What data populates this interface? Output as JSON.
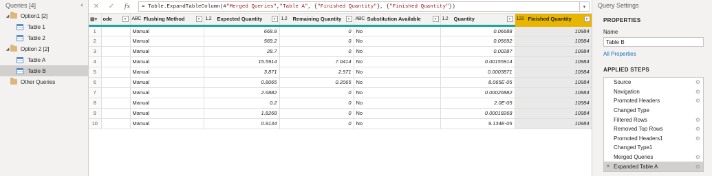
{
  "queries": {
    "title": "Queries [4]",
    "collapse_glyph": "‹",
    "groups": [
      {
        "label": "Option1 [2]",
        "items": [
          {
            "label": "Table 1"
          },
          {
            "label": "Table 2"
          }
        ]
      },
      {
        "label": "Option 2 [2]",
        "items": [
          {
            "label": "Table A"
          },
          {
            "label": "Table B"
          }
        ]
      }
    ],
    "other_label": "Other Queries",
    "selected": "Table B"
  },
  "formula_bar": {
    "cancel_glyph": "✕",
    "commit_glyph": "✓",
    "fx_label": "fx",
    "prefix": "= Table.ExpandTableColumn(#",
    "s1": "\"Merged Queries\"",
    "sep1": ", ",
    "s2": "\"Table A\"",
    "sep2": ", {",
    "s3": "\"Finished Quantity\"",
    "sep3": "}, {",
    "s4": "\"Finished Quantity\"",
    "suffix": "})",
    "expand_glyph": "▾"
  },
  "grid": {
    "corner_glyph": "▦▾",
    "columns": [
      {
        "type": "",
        "label": "ode"
      },
      {
        "type": "ABC",
        "label": "Flushing Method"
      },
      {
        "type": "1.2",
        "label": "Expected Quantity"
      },
      {
        "type": "1.2",
        "label": "Remaining Quantity"
      },
      {
        "type": "ABC",
        "label": "Substitution Available"
      },
      {
        "type": "1.2",
        "label": "Quantity"
      },
      {
        "type": "123",
        "label": "Finished Quantity"
      }
    ],
    "dropdown_glyph": "▾",
    "rows": [
      {
        "n": "1",
        "code": "",
        "flush": "Manual",
        "exp": "668.8",
        "rem": "0",
        "sub": "No",
        "qty": "0.06688",
        "fin": "10984"
      },
      {
        "n": "2",
        "code": "",
        "flush": "Manual",
        "exp": "569.2",
        "rem": "0",
        "sub": "No",
        "qty": "0.05692",
        "fin": "10984"
      },
      {
        "n": "3",
        "code": "",
        "flush": "Manual",
        "exp": "28.7",
        "rem": "0",
        "sub": "No",
        "qty": "0.00287",
        "fin": "10984"
      },
      {
        "n": "4",
        "code": "",
        "flush": "Manual",
        "exp": "15.5914",
        "rem": "7.0414",
        "sub": "No",
        "qty": "0.00155914",
        "fin": "10984"
      },
      {
        "n": "5",
        "code": "",
        "flush": "Manual",
        "exp": "3.871",
        "rem": "2.971",
        "sub": "No",
        "qty": "0.0003871",
        "fin": "10984"
      },
      {
        "n": "6",
        "code": "",
        "flush": "Manual",
        "exp": "0.8065",
        "rem": "0.2065",
        "sub": "No",
        "qty": "8.065E-05",
        "fin": "10984"
      },
      {
        "n": "7",
        "code": "",
        "flush": "Manual",
        "exp": "2.6882",
        "rem": "0",
        "sub": "No",
        "qty": "0.00026882",
        "fin": "10984"
      },
      {
        "n": "8",
        "code": "",
        "flush": "Manual",
        "exp": "0.2",
        "rem": "0",
        "sub": "No",
        "qty": "2.0E-05",
        "fin": "10984"
      },
      {
        "n": "9",
        "code": "",
        "flush": "Manual",
        "exp": "1.8268",
        "rem": "0",
        "sub": "No",
        "qty": "0.00018268",
        "fin": "10984"
      },
      {
        "n": "10",
        "code": "",
        "flush": "Manual",
        "exp": "0.9134",
        "rem": "0",
        "sub": "No",
        "qty": "9.134E-05",
        "fin": "10984"
      }
    ]
  },
  "settings": {
    "title": "Query Settings",
    "properties_head": "PROPERTIES",
    "name_label": "Name",
    "name_value": "Table B",
    "all_properties": "All Properties",
    "steps_head": "APPLIED STEPS",
    "gear_glyph": "⚙",
    "delete_glyph": "✕",
    "steps": [
      {
        "label": "Source",
        "gear": true
      },
      {
        "label": "Navigation",
        "gear": true
      },
      {
        "label": "Promoted Headers",
        "gear": true
      },
      {
        "label": "Changed Type",
        "gear": false
      },
      {
        "label": "Filtered Rows",
        "gear": true
      },
      {
        "label": "Removed Top Rows",
        "gear": true
      },
      {
        "label": "Promoted Headers1",
        "gear": true
      },
      {
        "label": "Changed Type1",
        "gear": false
      },
      {
        "label": "Merged Queries",
        "gear": true
      },
      {
        "label": "Expanded Table A",
        "gear": true
      }
    ],
    "active_step": "Expanded Table A"
  },
  "colors": {
    "header_accent": "#1aa3a3",
    "selected_column": "#e8b600",
    "link": "#0f6cbd",
    "folder": "#dcb67a"
  }
}
